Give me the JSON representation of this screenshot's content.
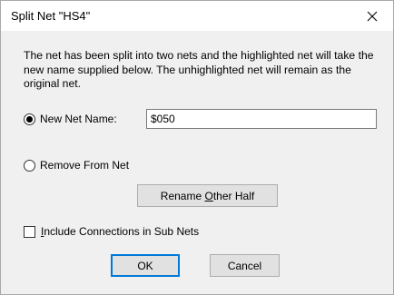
{
  "window": {
    "title": "Split Net \"HS4\"",
    "close_icon": "close-icon"
  },
  "description": "The net has been split into two nets and the highlighted net will take the new name supplied below. The unhighlighted net will remain as the original net.",
  "options": {
    "new_net_name_label": "New Net Name:",
    "new_net_name_value": "$050",
    "new_net_name_selected": true,
    "remove_from_net_label": "Remove From Net",
    "remove_from_net_selected": false
  },
  "rename_other_half": {
    "label_before": "Rename ",
    "label_mnemonic": "O",
    "label_after": "ther Half"
  },
  "include_connections": {
    "label_mnemonic": "I",
    "label_rest": "nclude Connections in Sub Nets",
    "checked": false
  },
  "buttons": {
    "ok_label": "OK",
    "cancel_label": "Cancel"
  },
  "colors": {
    "client_background": "#f0f0f0",
    "button_background": "#e1e1e1",
    "default_button_border": "#0078d7"
  }
}
